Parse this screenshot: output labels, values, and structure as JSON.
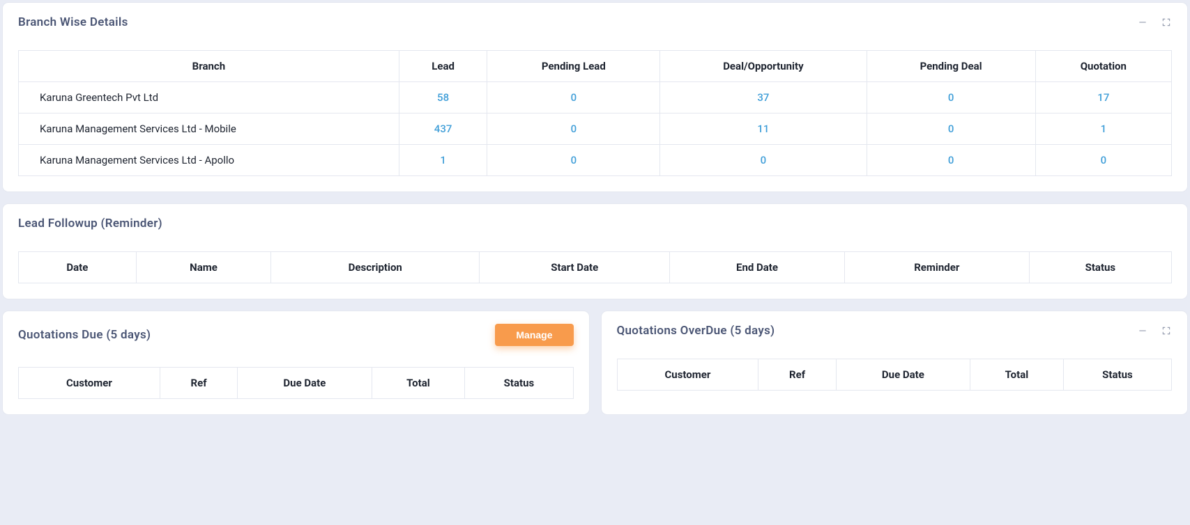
{
  "branchwise": {
    "title": "Branch Wise Details",
    "headers": {
      "branch": "Branch",
      "lead": "Lead",
      "pending_lead": "Pending Lead",
      "deal": "Deal/Opportunity",
      "pending_deal": "Pending Deal",
      "quotation": "Quotation"
    },
    "rows": [
      {
        "branch": "Karuna Greentech Pvt Ltd",
        "lead": "58",
        "pending_lead": "0",
        "deal": "37",
        "pending_deal": "0",
        "quotation": "17"
      },
      {
        "branch": "Karuna Management Services Ltd - Mobile",
        "lead": "437",
        "pending_lead": "0",
        "deal": "11",
        "pending_deal": "0",
        "quotation": "1"
      },
      {
        "branch": "Karuna Management Services Ltd - Apollo",
        "lead": "1",
        "pending_lead": "0",
        "deal": "0",
        "pending_deal": "0",
        "quotation": "0"
      }
    ]
  },
  "followup": {
    "title": "Lead Followup (Reminder)",
    "headers": {
      "date": "Date",
      "name": "Name",
      "description": "Description",
      "start_date": "Start Date",
      "end_date": "End Date",
      "reminder": "Reminder",
      "status": "Status"
    }
  },
  "quotations_due": {
    "title": "Quotations Due (5 days)",
    "manage_label": "Manage",
    "headers": {
      "customer": "Customer",
      "ref": "Ref",
      "due_date": "Due Date",
      "total": "Total",
      "status": "Status"
    }
  },
  "quotations_overdue": {
    "title": "Quotations OverDue (5 days)",
    "headers": {
      "customer": "Customer",
      "ref": "Ref",
      "due_date": "Due Date",
      "total": "Total",
      "status": "Status"
    }
  }
}
